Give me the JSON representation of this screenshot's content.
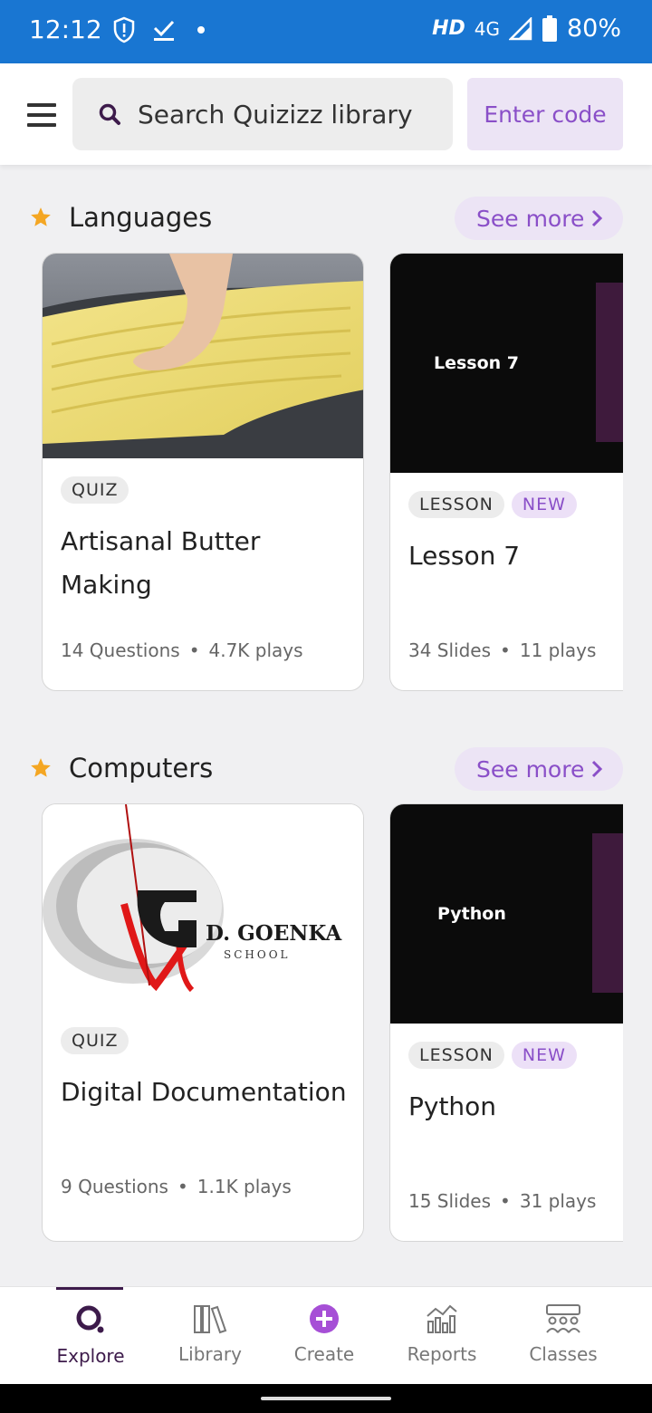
{
  "status_bar": {
    "time": "12:12",
    "hd": "HD",
    "network": "4G",
    "battery": "80%"
  },
  "app_bar": {
    "search_placeholder": "Search Quizizz library",
    "enter_code": "Enter code"
  },
  "sections": [
    {
      "title": "Languages",
      "see_more": "See more",
      "cards": [
        {
          "tag": "QUIZ",
          "title": "Artisanal Butter Making",
          "count": "14 Questions",
          "plays": "4.7K plays"
        },
        {
          "tag": "LESSON",
          "badge": "NEW",
          "thumb_label": "Lesson 7",
          "title": "Lesson 7",
          "count": "34 Slides",
          "plays": "11 plays"
        }
      ]
    },
    {
      "title": "Computers",
      "see_more": "See more",
      "cards": [
        {
          "tag": "QUIZ",
          "title": "Digital Documentation",
          "count": "9 Questions",
          "plays": "1.1K plays",
          "logo_text": "D. GOENKA",
          "logo_sub": "SCHOOL"
        },
        {
          "tag": "LESSON",
          "badge": "NEW",
          "thumb_label": "Python",
          "title": "Python",
          "count": "15 Slides",
          "plays": "31 plays"
        }
      ]
    }
  ],
  "bottom_nav": [
    {
      "label": "Explore",
      "active": true
    },
    {
      "label": "Library"
    },
    {
      "label": "Create"
    },
    {
      "label": "Reports"
    },
    {
      "label": "Classes"
    }
  ],
  "colors": {
    "status_bar": "#1976d2",
    "accent_purple": "#8a4fc8",
    "dark_purple": "#3d1b4b",
    "star": "#f4a623"
  }
}
